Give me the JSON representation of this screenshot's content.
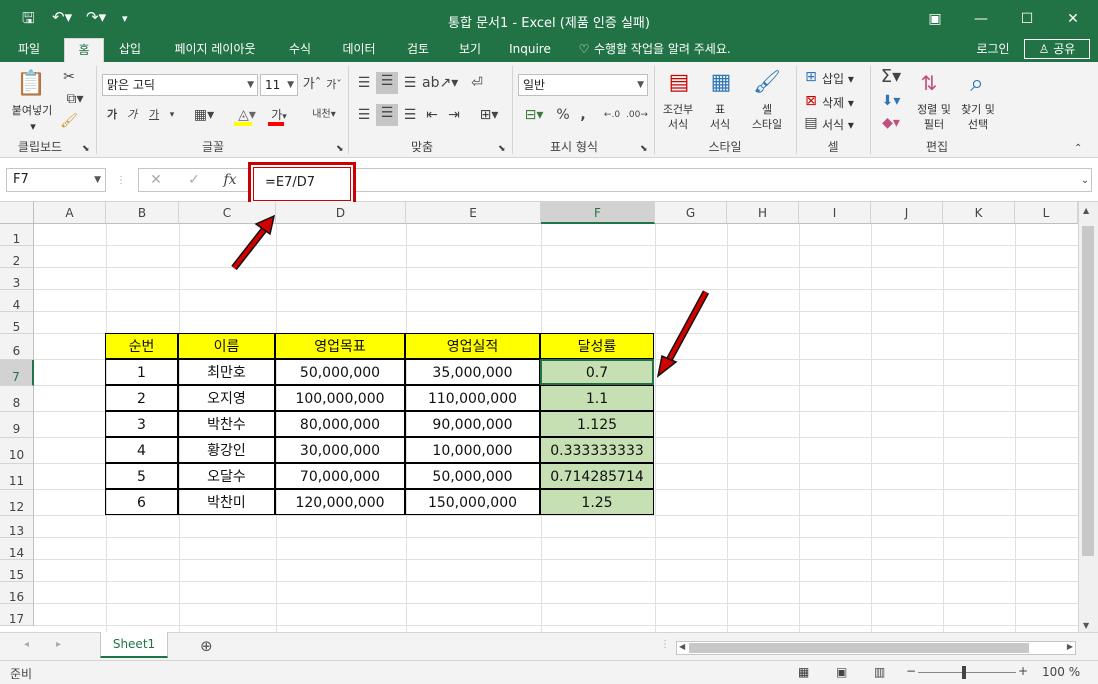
{
  "titlebar": {
    "title": "통합 문서1 - Excel (제품 인증 실패)",
    "icons": [
      "save-icon",
      "undo-icon",
      "redo-icon",
      "customize-icon"
    ]
  },
  "tabs": [
    "파일",
    "홈",
    "삽입",
    "페이지 레이아웃",
    "수식",
    "데이터",
    "검토",
    "보기",
    "Inquire"
  ],
  "tell_me": "수행할 작업을 알려 주세요.",
  "login": "로그인",
  "share": "공유",
  "ribbon": {
    "clipboard": {
      "paste": "붙여넣기",
      "label": "클립보드"
    },
    "font": {
      "name": "맑은 고딕",
      "size": "11",
      "label": "글꼴",
      "bold": "가",
      "italic": "가",
      "underline": "가",
      "font_color": "가",
      "phonetic": "내천"
    },
    "alignment": {
      "label": "맞춤"
    },
    "number": {
      "format": "일반",
      "percent": "%",
      "comma": ",",
      "label": "표시 형식"
    },
    "styles": {
      "conditional": "조건부\n서식",
      "table": "표\n서식",
      "cell_style": "셀\n스타일",
      "label": "스타일"
    },
    "cells": {
      "insert": "삽입",
      "delete": "삭제",
      "format": "서식",
      "label": "셀"
    },
    "editing": {
      "sort": "정렬 및\n필터",
      "find": "찾기 및\n선택",
      "label": "편집"
    }
  },
  "formula_bar": {
    "name_box": "F7",
    "formula": "=E7/D7"
  },
  "columns": [
    "A",
    "B",
    "C",
    "D",
    "E",
    "F",
    "G",
    "H",
    "I",
    "J",
    "K",
    "L"
  ],
  "rows": [
    "1",
    "2",
    "3",
    "4",
    "5",
    "6",
    "7",
    "8",
    "9",
    "10",
    "11",
    "12",
    "13",
    "14",
    "15",
    "16",
    "17"
  ],
  "table": {
    "headers": [
      "순번",
      "이름",
      "영업목표",
      "영업실적",
      "달성률"
    ],
    "rows": [
      [
        "1",
        "최만호",
        "50,000,000",
        "35,000,000",
        "0.7"
      ],
      [
        "2",
        "오지영",
        "100,000,000",
        "110,000,000",
        "1.1"
      ],
      [
        "3",
        "박찬수",
        "80,000,000",
        "90,000,000",
        "1.125"
      ],
      [
        "4",
        "황강인",
        "30,000,000",
        "10,000,000",
        "0.333333333"
      ],
      [
        "5",
        "오달수",
        "70,000,000",
        "50,000,000",
        "0.714285714"
      ],
      [
        "6",
        "박찬미",
        "120,000,000",
        "150,000,000",
        "1.25"
      ]
    ]
  },
  "sheet_tab": "Sheet1",
  "status": {
    "ready": "준비",
    "zoom": "100 %"
  },
  "colors": {
    "excel_green": "#217346",
    "header_fill": "#ffff00",
    "result_fill": "#c6e0b4",
    "annotation_red": "#cc0000"
  }
}
